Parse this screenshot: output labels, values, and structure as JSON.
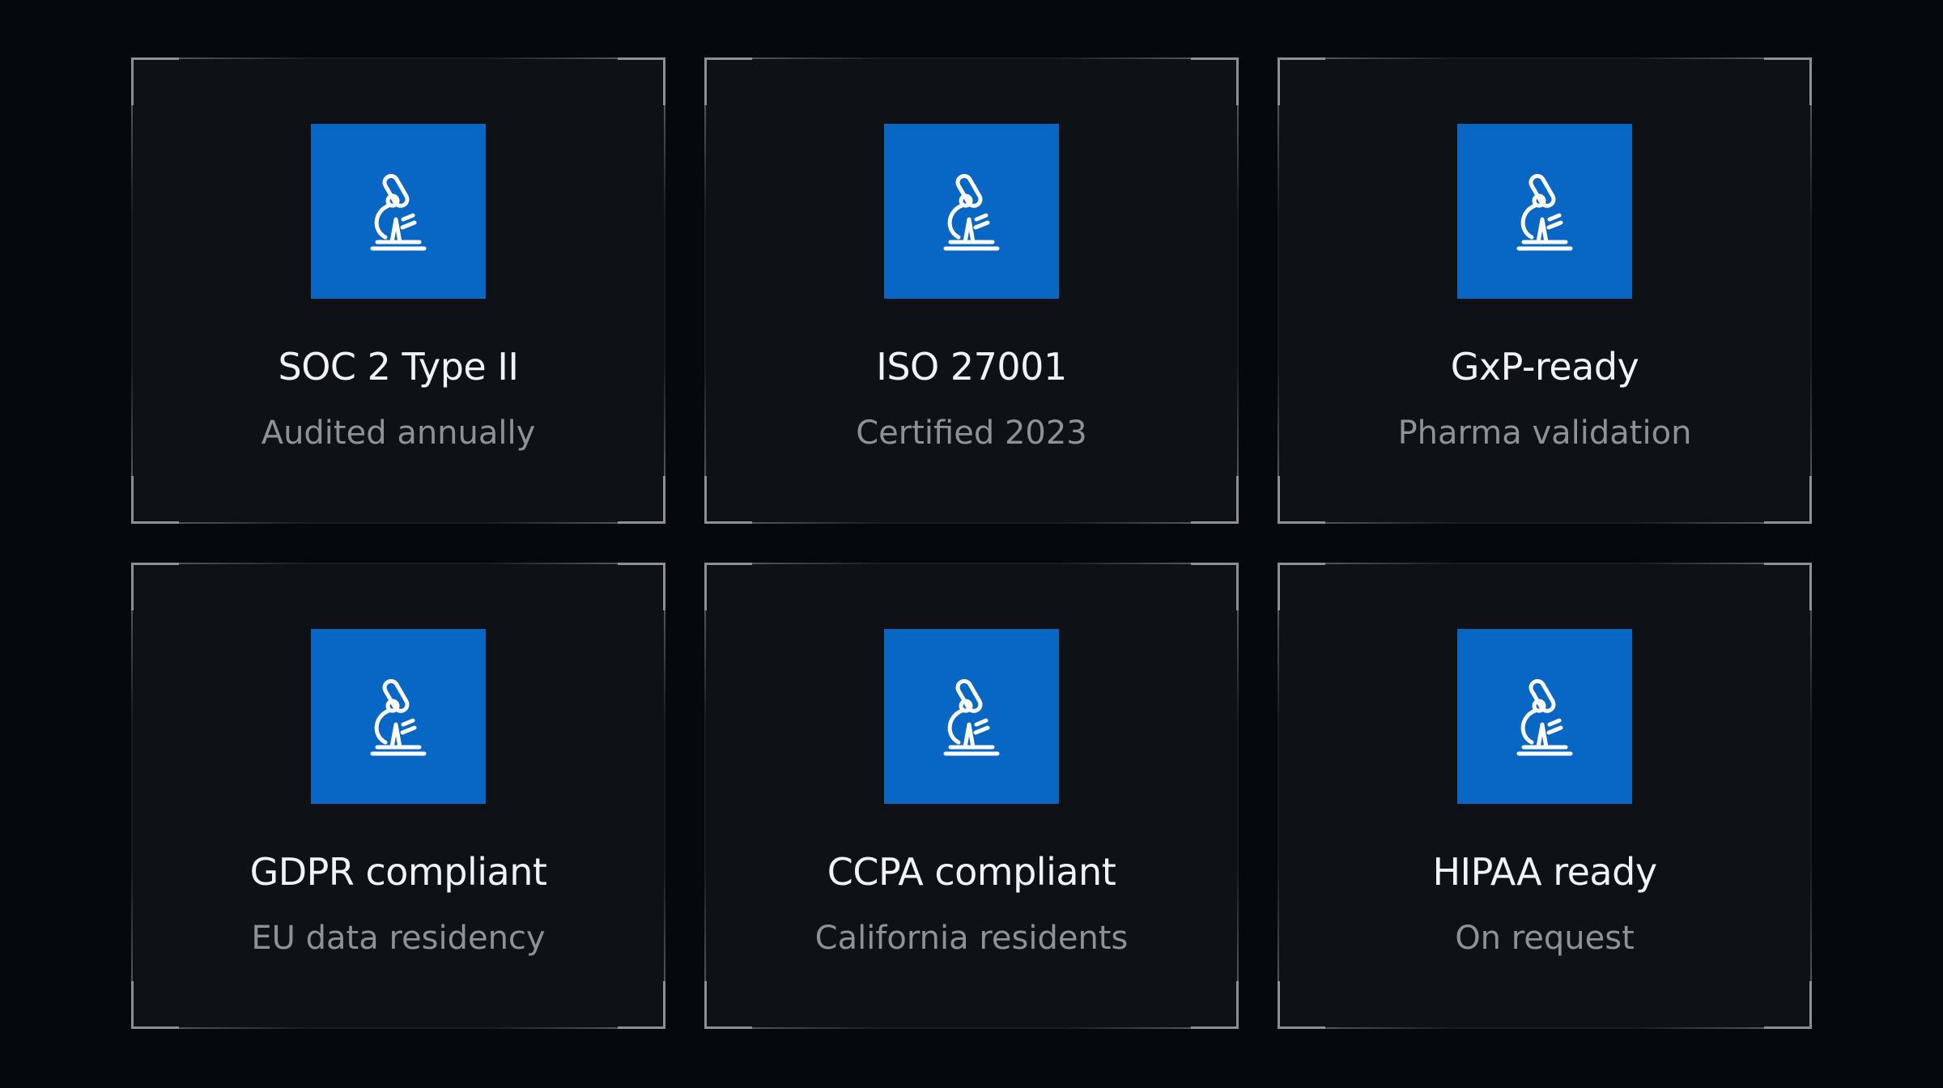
{
  "colors": {
    "background": "#05080d",
    "card": "#0e1116",
    "accent": "#0866c4",
    "title": "#f1f3f6",
    "subtitle": "#8d9299"
  },
  "cards": [
    {
      "icon": "microscope-icon",
      "title": "SOC 2 Type II",
      "subtitle": "Audited annually"
    },
    {
      "icon": "microscope-icon",
      "title": "ISO 27001",
      "subtitle": "Certified 2023"
    },
    {
      "icon": "microscope-icon",
      "title": "GxP-ready",
      "subtitle": "Pharma validation"
    },
    {
      "icon": "microscope-icon",
      "title": "GDPR compliant",
      "subtitle": "EU data residency"
    },
    {
      "icon": "microscope-icon",
      "title": "CCPA compliant",
      "subtitle": "California residents"
    },
    {
      "icon": "microscope-icon",
      "title": "HIPAA ready",
      "subtitle": "On request"
    }
  ]
}
